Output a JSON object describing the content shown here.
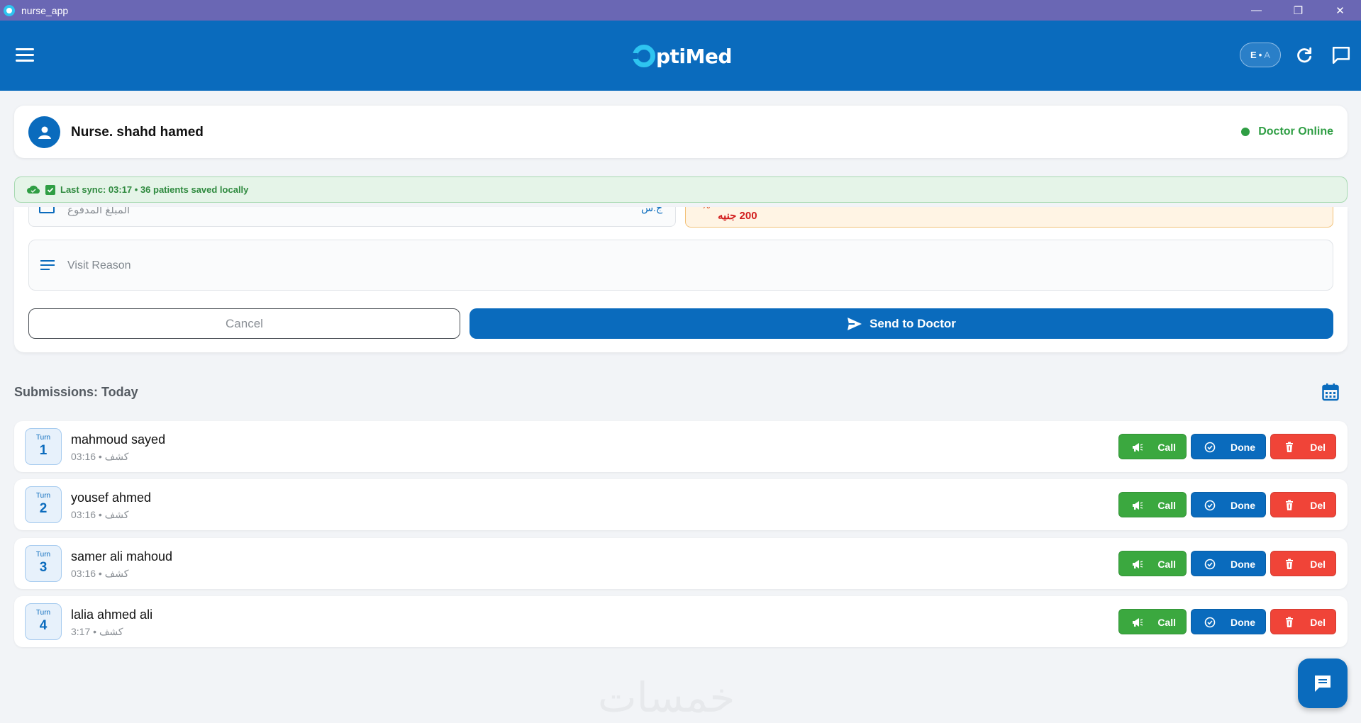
{
  "window": {
    "title": "nurse_app",
    "controls": {
      "minimize": "—",
      "restore": "❐",
      "close": "✕"
    }
  },
  "header": {
    "logo_text": "ptiMed",
    "lang_active": "E",
    "lang_sep": "•",
    "lang_inactive": "A",
    "icons": [
      "menu-icon",
      "refresh-icon",
      "chat-icon"
    ]
  },
  "nurse_card": {
    "name": "Nurse. shahd hamed",
    "doctor_status": "Doctor Online",
    "status_color": "#2f9e44"
  },
  "sync": {
    "text": "Last sync: 03:17 • 36 patients saved locally"
  },
  "form": {
    "amount_label": "المبلغ المدفوع",
    "amount_suffix": "ج.س",
    "price_text": "200 جنيه",
    "visit_reason_placeholder": "Visit Reason",
    "cancel_label": "Cancel",
    "send_label": "Send to Doctor"
  },
  "submissions": {
    "title": "Submissions: Today",
    "turn_label": "Turn",
    "actions": {
      "call": "Call",
      "done": "Done",
      "del": "Del"
    },
    "rows": [
      {
        "turn": "1",
        "name": "mahmoud sayed",
        "time": "03:16",
        "type": "كشف"
      },
      {
        "turn": "2",
        "name": "yousef ahmed",
        "time": "03:16",
        "type": "كشف"
      },
      {
        "turn": "3",
        "name": "samer ali mahoud",
        "time": "03:16",
        "type": "كشف"
      },
      {
        "turn": "4",
        "name": "lalia ahmed ali",
        "time": "3:17",
        "type": "كشف"
      }
    ]
  },
  "watermark": "خمسات",
  "colors": {
    "primary": "#0a6bbd",
    "accent": "#2ec4f0",
    "call": "#3ba83f",
    "delete": "#f04438",
    "titlebar": "#6a67b4"
  }
}
